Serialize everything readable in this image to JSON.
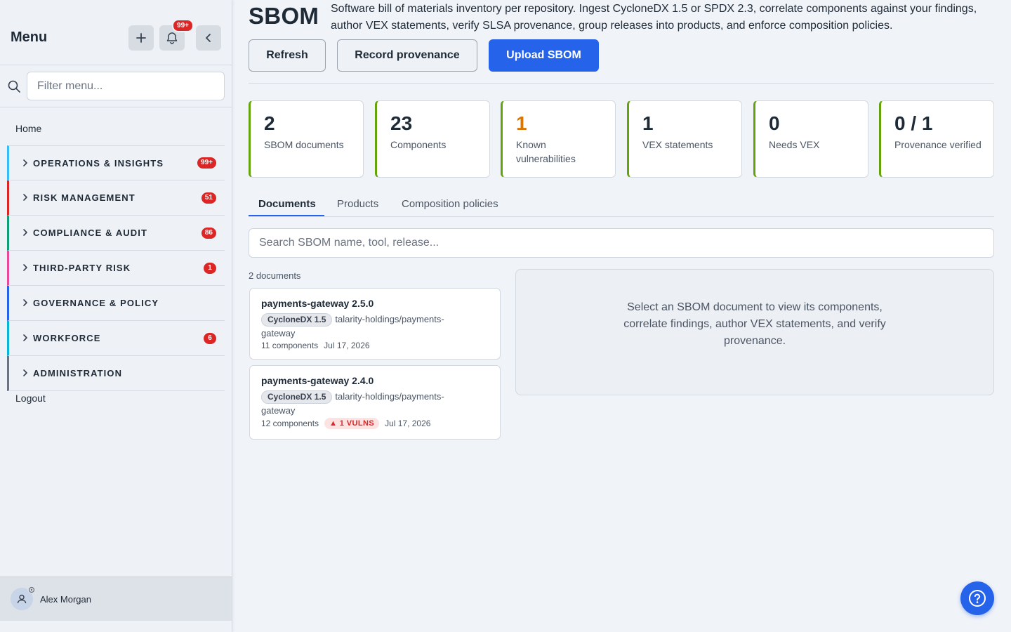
{
  "sidebar": {
    "title": "Menu",
    "notification_count": "99+",
    "filter_placeholder": "Filter menu...",
    "home": "Home",
    "items": [
      {
        "label": "OPERATIONS & INSIGHTS",
        "badge": "99+",
        "color": "#38bdf8"
      },
      {
        "label": "RISK MANAGEMENT",
        "badge": "51",
        "color": "#dc2626"
      },
      {
        "label": "COMPLIANCE & AUDIT",
        "badge": "86",
        "color": "#0f9d76"
      },
      {
        "label": "THIRD-PARTY RISK",
        "badge": "1",
        "color": "#ec4899"
      },
      {
        "label": "GOVERNANCE & POLICY",
        "badge": "",
        "color": "#2563eb"
      },
      {
        "label": "WORKFORCE",
        "badge": "6",
        "color": "#06b6d4"
      },
      {
        "label": "ADMINISTRATION",
        "badge": "",
        "color": "#6b7280"
      }
    ],
    "logout": "Logout",
    "user_name": "Alex Morgan"
  },
  "page": {
    "title": "SBOM",
    "description": "Software bill of materials inventory per repository. Ingest CycloneDX 1.5 or SPDX 2.3, correlate components against your findings, author VEX statements, verify SLSA provenance, group releases into products, and enforce composition policies."
  },
  "actions": {
    "refresh": "Refresh",
    "record_provenance": "Record provenance",
    "upload_sbom": "Upload SBOM"
  },
  "stats": [
    {
      "value": "2",
      "label": "SBOM documents"
    },
    {
      "value": "23",
      "label": "Components"
    },
    {
      "value": "1",
      "label": "Known vulnerabilities"
    },
    {
      "value": "1",
      "label": "VEX statements"
    },
    {
      "value": "0",
      "label": "Needs VEX"
    },
    {
      "value": "0 / 1",
      "label": "Provenance verified"
    }
  ],
  "tabs": [
    "Documents",
    "Products",
    "Composition policies"
  ],
  "search_placeholder": "Search SBOM name, tool, release...",
  "document_count": "2 documents",
  "documents": [
    {
      "name": "payments-gateway 2.5.0",
      "format": "CycloneDX 1.5",
      "repo": "talarity-holdings/payments-gateway",
      "components": "11 components",
      "vulns": "",
      "date": "Jul 17, 2026"
    },
    {
      "name": "payments-gateway 2.4.0",
      "format": "CycloneDX 1.5",
      "repo": "talarity-holdings/payments-gateway",
      "components": "12 components",
      "vulns": "▲ 1 VULNS",
      "date": "Jul 17, 2026"
    }
  ],
  "detail_placeholder": "Select an SBOM document to view its components, correlate findings, author VEX statements, and verify provenance.",
  "colors": {
    "accent": "#2563eb",
    "stat_border": "#65a30d",
    "danger": "#dc2626",
    "warning": "#d97706"
  }
}
